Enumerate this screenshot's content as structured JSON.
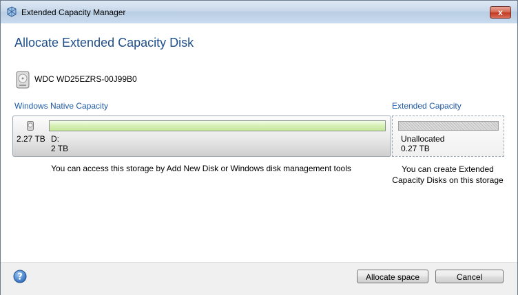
{
  "window": {
    "title": "Extended Capacity Manager",
    "close_glyph": "x"
  },
  "page": {
    "heading": "Allocate Extended Capacity Disk"
  },
  "disk": {
    "name": "WDC WD25EZRS-00J99B0",
    "icon": "hard-disk-icon"
  },
  "native": {
    "label": "Windows Native Capacity",
    "total_size": "2.27 TB",
    "partition_letter": "D:",
    "partition_size": "2 TB",
    "note": "You can access this storage by Add New Disk or Windows disk management tools",
    "bar_color": "#c4e69a"
  },
  "extended": {
    "label": "Extended Capacity",
    "unallocated_label": "Unallocated",
    "unallocated_size": "0.27 TB",
    "note": "You can create Extended Capacity Disks on this storage"
  },
  "footer": {
    "help_icon": "help-icon",
    "allocate_label": "Allocate space",
    "cancel_label": "Cancel"
  },
  "colors": {
    "heading": "#1e4e8c",
    "section_label": "#1e5aa8",
    "close_button": "#c43a22"
  }
}
